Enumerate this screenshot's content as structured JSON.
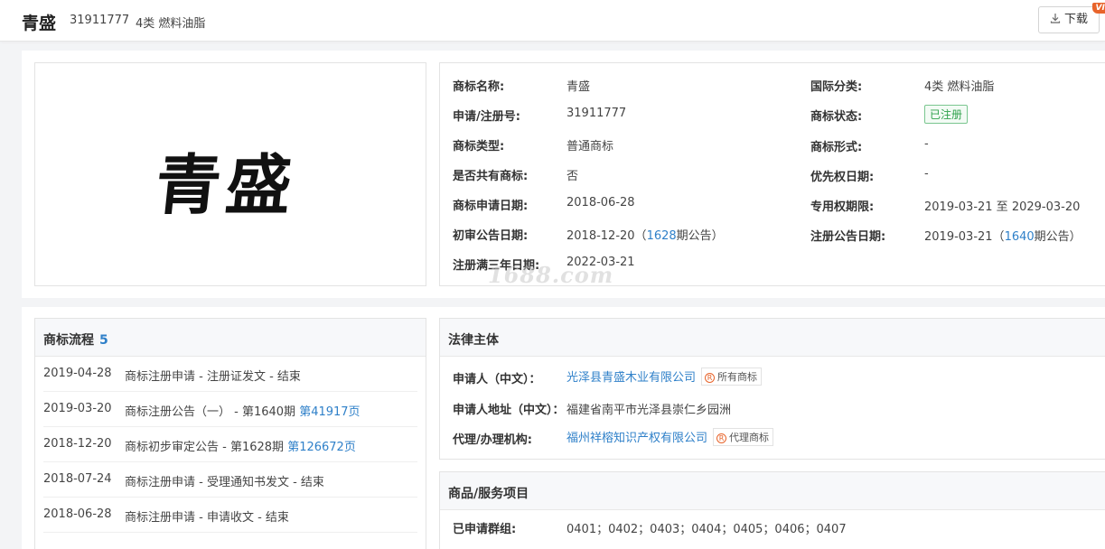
{
  "header": {
    "name": "青盛",
    "reg_no": "31911777",
    "class": "4类 燃料油脂",
    "download_label": "下载",
    "vip_badge": "VIP"
  },
  "logo": {
    "text": "青盛"
  },
  "info": {
    "left": [
      {
        "label": "商标名称:",
        "value": "青盛"
      },
      {
        "label": "申请/注册号:",
        "value": "31911777"
      },
      {
        "label": "商标类型:",
        "value": "普通商标"
      },
      {
        "label": "是否共有商标:",
        "value": "否"
      },
      {
        "label": "商标申请日期:",
        "value": "2018-06-28"
      },
      {
        "label": "初审公告日期:",
        "value_prefix": "2018-12-20（",
        "link": "1628",
        "value_suffix": "期公告）"
      },
      {
        "label": "注册满三年日期:",
        "value": "2022-03-21"
      }
    ],
    "right": [
      {
        "label": "国际分类:",
        "value": "4类 燃料油脂"
      },
      {
        "label": "商标状态:",
        "value": "已注册"
      },
      {
        "label": "商标形式:",
        "value": "-"
      },
      {
        "label": "优先权日期:",
        "value": "-"
      },
      {
        "label": "专用权期限:",
        "value": "2019-03-21 至 2029-03-20"
      },
      {
        "label": "注册公告日期:",
        "value_prefix": "2019-03-21（",
        "link": "1640",
        "value_suffix": "期公告）"
      }
    ]
  },
  "watermark": "1688.com",
  "flow": {
    "title": "商标流程",
    "count": "5",
    "rows": [
      {
        "date": "2019-04-28",
        "desc": "商标注册申请 - 注册证发文 - 结束",
        "link": ""
      },
      {
        "date": "2019-03-20",
        "desc": "商标注册公告（一） - 第1640期 ",
        "link": "第41917页"
      },
      {
        "date": "2018-12-20",
        "desc": "商标初步审定公告 - 第1628期 ",
        "link": "第126672页"
      },
      {
        "date": "2018-07-24",
        "desc": "商标注册申请 - 受理通知书发文 - 结束",
        "link": ""
      },
      {
        "date": "2018-06-28",
        "desc": "商标注册申请 - 申请收文 - 结束",
        "link": ""
      }
    ]
  },
  "legal": {
    "title": "法律主体",
    "applicant_label": "申请人（中文）：",
    "applicant": "光泽县青盛木业有限公司",
    "applicant_tag": "所有商标",
    "address_label": "申请人地址（中文）：",
    "address": "福建省南平市光泽县崇仁乡园洲",
    "agent_label": "代理/办理机构:",
    "agent": "福州祥榕知识产权有限公司",
    "agent_tag": "代理商标"
  },
  "goods": {
    "title": "商品/服务项目",
    "group_label": "已申请群组:",
    "groups": "0401；0402；0403；0404；0405；0406；0407"
  },
  "colors": {
    "link": "#2f80c9",
    "status_green": "#2fa24c",
    "vip": "#e8642b"
  }
}
